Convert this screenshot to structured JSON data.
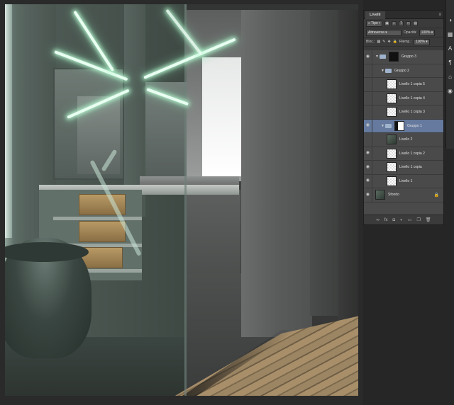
{
  "panel": {
    "tab": "Livelli",
    "filter_kind": "Tipo",
    "blend_mode": "Attraversa",
    "opacity_label": "Opacità:",
    "opacity_value": "100%",
    "lock_label": "Bloc.:",
    "fill_label": "Riemp.:",
    "fill_value": "100%"
  },
  "layers": [
    {
      "name": "Gruppo 3",
      "type": "group",
      "visible": true,
      "expanded": true,
      "indent": 0,
      "has_mask": true,
      "mask": "black"
    },
    {
      "name": "Gruppo 2",
      "type": "group",
      "visible": false,
      "expanded": true,
      "indent": 1
    },
    {
      "name": "Livello 1 copia 5",
      "type": "layer",
      "visible": false,
      "indent": 2
    },
    {
      "name": "Livello 1 copia 4",
      "type": "layer",
      "visible": false,
      "indent": 2
    },
    {
      "name": "Livello 1 copia 3",
      "type": "layer",
      "visible": false,
      "indent": 2
    },
    {
      "name": "Gruppo 1",
      "type": "group",
      "visible": true,
      "expanded": true,
      "indent": 1,
      "selected": true,
      "has_mask": true,
      "mask": "white"
    },
    {
      "name": "Livello 2",
      "type": "layer",
      "visible": false,
      "indent": 2,
      "thumb": "image"
    },
    {
      "name": "Livello 1 copia 2",
      "type": "layer",
      "visible": true,
      "indent": 2
    },
    {
      "name": "Livello 1 copia",
      "type": "layer",
      "visible": true,
      "indent": 2
    },
    {
      "name": "Livello 1",
      "type": "layer",
      "visible": true,
      "indent": 2
    },
    {
      "name": "Sfondo",
      "type": "background",
      "visible": true,
      "indent": 0,
      "thumb": "image",
      "locked": true
    }
  ],
  "colors": {
    "selected_row": "#657a9e",
    "panel_bg": "#3b3b3b",
    "workspace_bg": "#2a2a2a"
  }
}
